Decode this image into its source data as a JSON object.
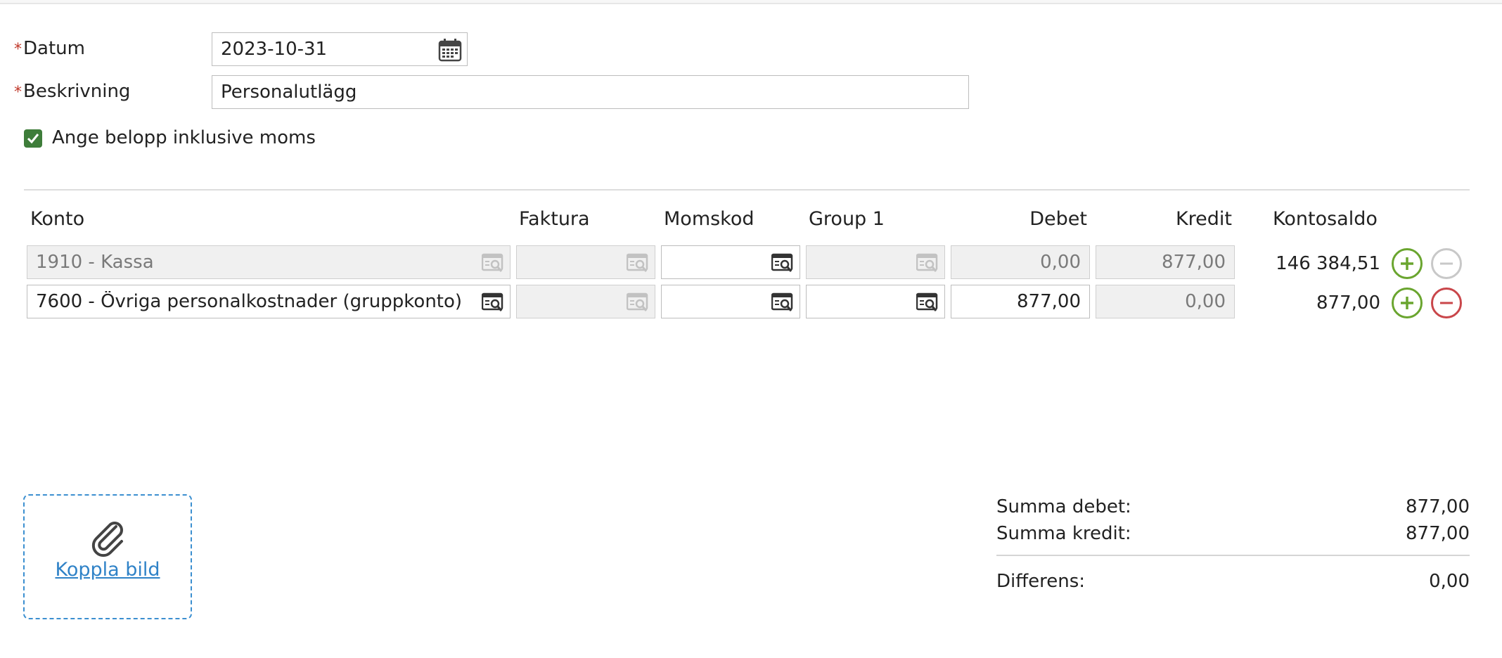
{
  "form": {
    "date_label": "Datum",
    "date_value": "2023-10-31",
    "description_label": "Beskrivning",
    "description_value": "Personalutlägg",
    "required_mark": "*",
    "vat_checkbox_label": "Ange belopp inklusive moms",
    "vat_checkbox_checked": true
  },
  "table": {
    "headers": {
      "konto": "Konto",
      "faktura": "Faktura",
      "momskod": "Momskod",
      "group1": "Group 1",
      "debet": "Debet",
      "kredit": "Kredit",
      "kontosaldo": "Kontosaldo"
    },
    "rows": [
      {
        "konto": "1910 - Kassa",
        "faktura": "",
        "momskod": "",
        "group1": "",
        "debet": "0,00",
        "kredit": "877,00",
        "kontosaldo": "146 384,51"
      },
      {
        "konto": "7600 - Övriga personalkostnader (gruppkonto)",
        "faktura": "",
        "momskod": "",
        "group1": "",
        "debet": "877,00",
        "kredit": "0,00",
        "kontosaldo": "877,00"
      }
    ]
  },
  "attachment": {
    "link_label": "Koppla bild",
    "icon": "paperclip-icon"
  },
  "summary": {
    "debit_label": "Summa debet:",
    "debit_value": "877,00",
    "credit_label": "Summa kredit:",
    "credit_value": "877,00",
    "diff_label": "Differens:",
    "diff_value": "0,00"
  },
  "colors": {
    "required": "#c0392b",
    "checkbox": "#3e7d3a",
    "add": "#6aa52f",
    "remove": "#c9464a",
    "link": "#2f82c7"
  }
}
